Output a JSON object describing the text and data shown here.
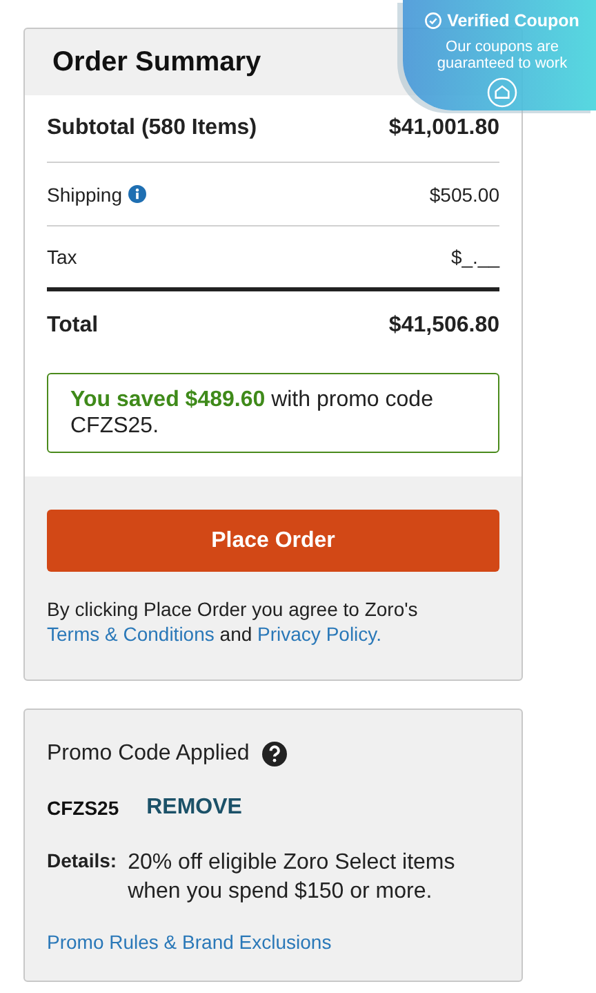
{
  "order_summary": {
    "title": "Order Summary",
    "lines": [
      {
        "kind": "subtotal",
        "label": "Subtotal (580 Items)",
        "value": "$41,001.80"
      },
      {
        "kind": "shipping",
        "label": "Shipping",
        "value": "$505.00"
      },
      {
        "kind": "tax",
        "label": "Tax",
        "value": "$_.__"
      },
      {
        "kind": "total",
        "label": "Total",
        "value": "$41,506.80"
      }
    ],
    "savings": "**You saved $489.60** with promo code CFZS25.",
    "place_order": "Place Order",
    "terms": {
      "before": "By clicking Place Order you agree to Zoro's",
      "link_1": "Terms & Conditions",
      "middle": "and",
      "link_2": "Privacy Policy."
    }
  },
  "promo": {
    "title": "Promo Code Applied",
    "code": "CFZS25",
    "remove": "REMOVE",
    "details_label": "Details:",
    "details": "20% off eligible Zoro Select items when you spend $150 or more.",
    "rules_link": "Promo Rules & Brand Exclusions"
  },
  "coupon_badge": {
    "title": "Verified Coupon",
    "text": "Our coupons are guaranteed to work"
  }
}
